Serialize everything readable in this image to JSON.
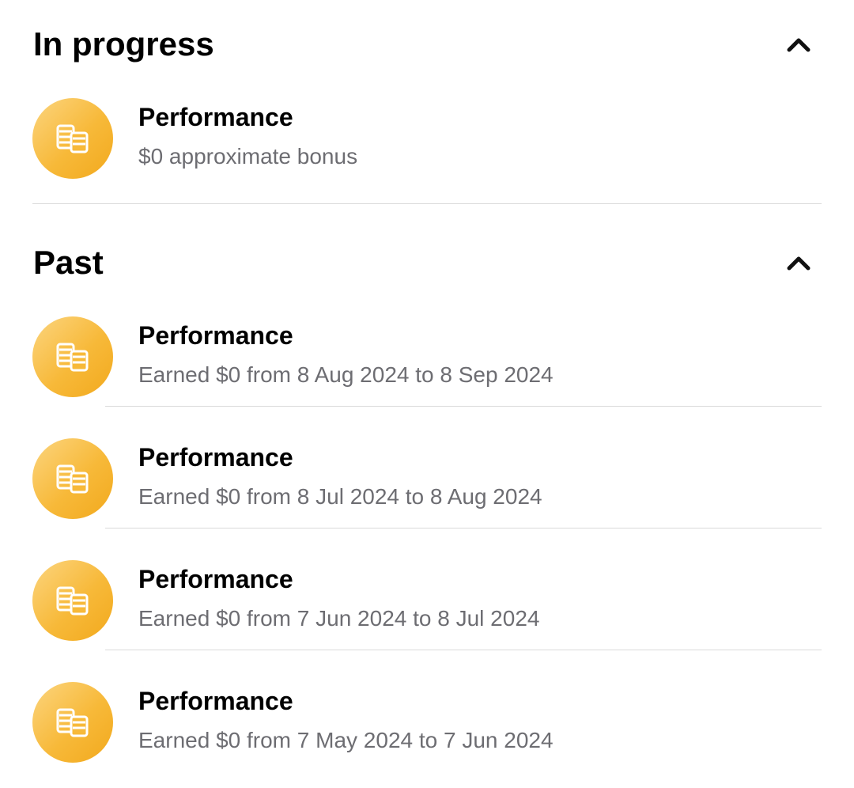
{
  "in_progress": {
    "title": "In progress",
    "toggle_icon": "chevron-up-icon",
    "items": [
      {
        "title": "Performance",
        "subtitle": "$0 approximate bonus",
        "icon": "coins-icon"
      }
    ]
  },
  "past": {
    "title": "Past",
    "toggle_icon": "chevron-up-icon",
    "items": [
      {
        "title": "Performance",
        "subtitle": "Earned $0 from 8 Aug 2024 to 8 Sep 2024",
        "icon": "coins-icon"
      },
      {
        "title": "Performance",
        "subtitle": "Earned $0 from 8 Jul 2024 to 8 Aug 2024",
        "icon": "coins-icon"
      },
      {
        "title": "Performance",
        "subtitle": "Earned $0 from 7 Jun 2024 to 8 Jul 2024",
        "icon": "coins-icon"
      },
      {
        "title": "Performance",
        "subtitle": "Earned $0 from 7 May 2024 to 7 Jun 2024",
        "icon": "coins-icon"
      }
    ]
  },
  "colors": {
    "coin_badge_light": "#fcd57f",
    "coin_badge_dark": "#f2a91d",
    "subtitle_gray": "#6d6d72",
    "divider_gray": "#dadada"
  }
}
